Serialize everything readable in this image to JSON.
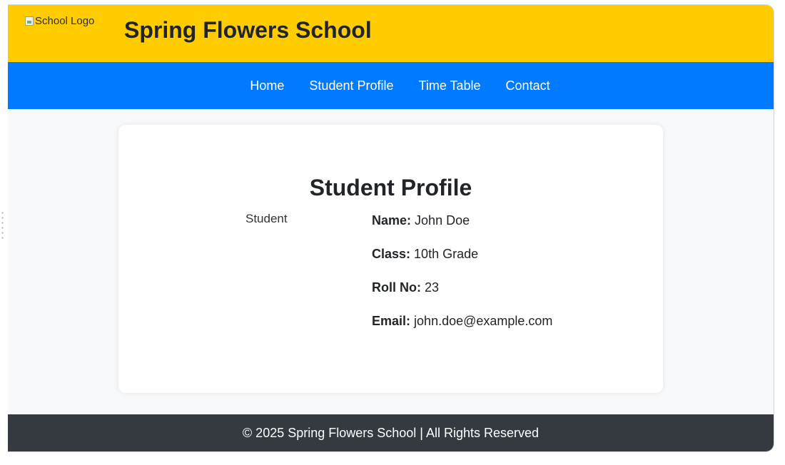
{
  "header": {
    "logo_alt": "School Logo",
    "title": "Spring Flowers School"
  },
  "nav": {
    "items": [
      {
        "label": "Home"
      },
      {
        "label": "Student Profile"
      },
      {
        "label": "Time Table"
      },
      {
        "label": "Contact"
      }
    ]
  },
  "profile": {
    "title": "Student Profile",
    "photo_alt": "Student",
    "fields": [
      {
        "label": "Name:",
        "value": "John Doe"
      },
      {
        "label": "Class:",
        "value": "10th Grade"
      },
      {
        "label": "Roll No:",
        "value": "23"
      },
      {
        "label": "Email:",
        "value": "john.doe@example.com"
      }
    ]
  },
  "footer": {
    "text": "© 2025 Spring Flowers School | All Rights Reserved"
  },
  "colors": {
    "header_bg": "#ffcc00",
    "nav_bg": "#007bff",
    "footer_bg": "#343a40"
  }
}
